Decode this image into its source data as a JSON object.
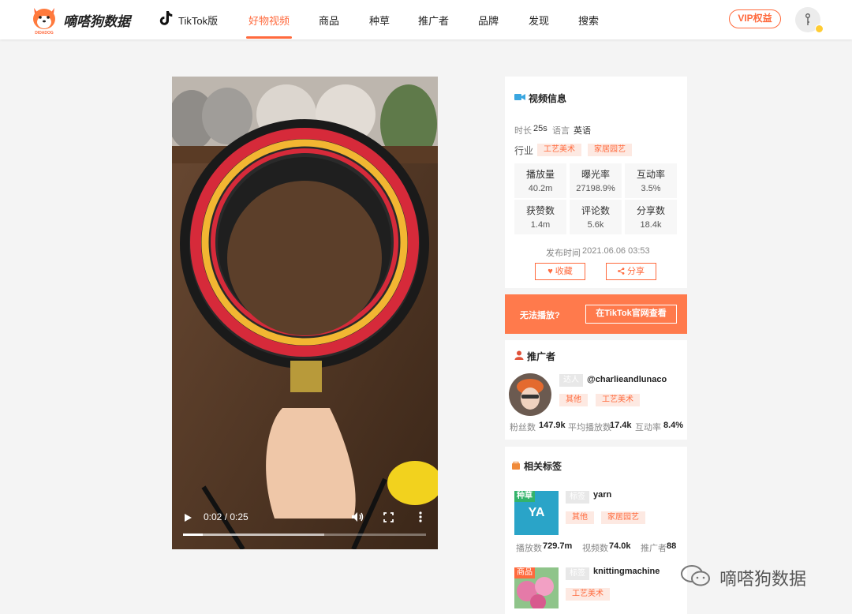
{
  "header": {
    "brand_name": "嘀嗒狗数据",
    "brand_logo_caption": "DIDADOG",
    "platform_label": "TikTok版",
    "nav": [
      "好物视频",
      "商品",
      "种草",
      "推广者",
      "品牌",
      "发现",
      "搜索"
    ],
    "active_nav": "好物视频",
    "vip_label": "VIP权益"
  },
  "video": {
    "time": "0:02 / 0:25",
    "played_fraction": 0.08,
    "buffered_fraction": 0.58
  },
  "video_info": {
    "title": "视频信息",
    "duration_label": "时长",
    "duration": "25s",
    "language_label": "语言",
    "language": "英语",
    "industry_label": "行业",
    "industries": [
      "工艺美术",
      "家居园艺"
    ],
    "stats": [
      {
        "label": "播放量",
        "value": "40.2m"
      },
      {
        "label": "曝光率",
        "value": "27198.9%"
      },
      {
        "label": "互动率",
        "value": "3.5%"
      },
      {
        "label": "获赞数",
        "value": "1.4m"
      },
      {
        "label": "评论数",
        "value": "5.6k"
      },
      {
        "label": "分享数",
        "value": "18.4k"
      }
    ],
    "published_label": "发布时间",
    "published": "2021.06.06 03:53",
    "favorite_label": "收藏",
    "share_label": "分享"
  },
  "play_banner": {
    "cannot_play": "无法播放?",
    "watch_on_tiktok": "在TikTok官网查看"
  },
  "promoter": {
    "title": "推广者",
    "badge": "达人",
    "handle": "@charlieandlunaco",
    "tags": [
      "其他",
      "工艺美术"
    ],
    "followers_label": "粉丝数",
    "followers": "147.9k",
    "avg_views_label": "平均播放数",
    "avg_views": "17.4k",
    "engagement_label": "互动率",
    "engagement": "8.4%"
  },
  "related_tags": {
    "title": "相关标签",
    "items": [
      {
        "corner": "种草",
        "corner_color": "#33b36b",
        "thumb_text": "YA",
        "badge": "标签",
        "name": "yarn",
        "tags": [
          "其他",
          "家居园艺"
        ],
        "plays_label": "播放数",
        "plays": "729.7m",
        "videos_label": "视频数",
        "videos": "74.0k",
        "promoters_label": "推广者",
        "promoters": "88"
      },
      {
        "corner": "商品",
        "corner_color": "#ff6a3d",
        "badge": "标签",
        "name": "knittingmachine",
        "tags": [
          "工艺美术"
        ]
      }
    ]
  },
  "watermark": "嘀嗒狗数据",
  "colors": {
    "accent": "#ff6a3d",
    "banner": "#ff7a4c",
    "tag_bg": "#fde9e2"
  }
}
